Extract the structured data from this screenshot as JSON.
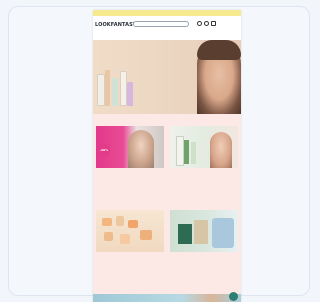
{
  "announcement": "",
  "brand": {
    "logo": "LOOKFANTASTIC"
  },
  "search": {
    "placeholder": ""
  },
  "header_icons": [
    "account-icon",
    "wishlist-icon",
    "basket-icon"
  ],
  "nav": {
    "items": [
      "",
      "",
      "",
      "",
      "",
      "",
      "",
      ""
    ]
  },
  "hero": {
    "title": "",
    "subtitle": ""
  },
  "promo_tiles": [
    {
      "badge": "-20%",
      "title": "",
      "text": "",
      "link": ""
    },
    {
      "title": "",
      "text": "",
      "link": ""
    },
    {
      "title": "",
      "text": "",
      "link": ""
    },
    {
      "title": "",
      "text": "",
      "link": ""
    }
  ],
  "colors": {
    "announcement_bar": "#f7ea8e",
    "nav_bar": "#3c7c72",
    "promo_background": "#fce8e5",
    "badge": "#e23b89",
    "chat_button": "#2d7e73"
  }
}
